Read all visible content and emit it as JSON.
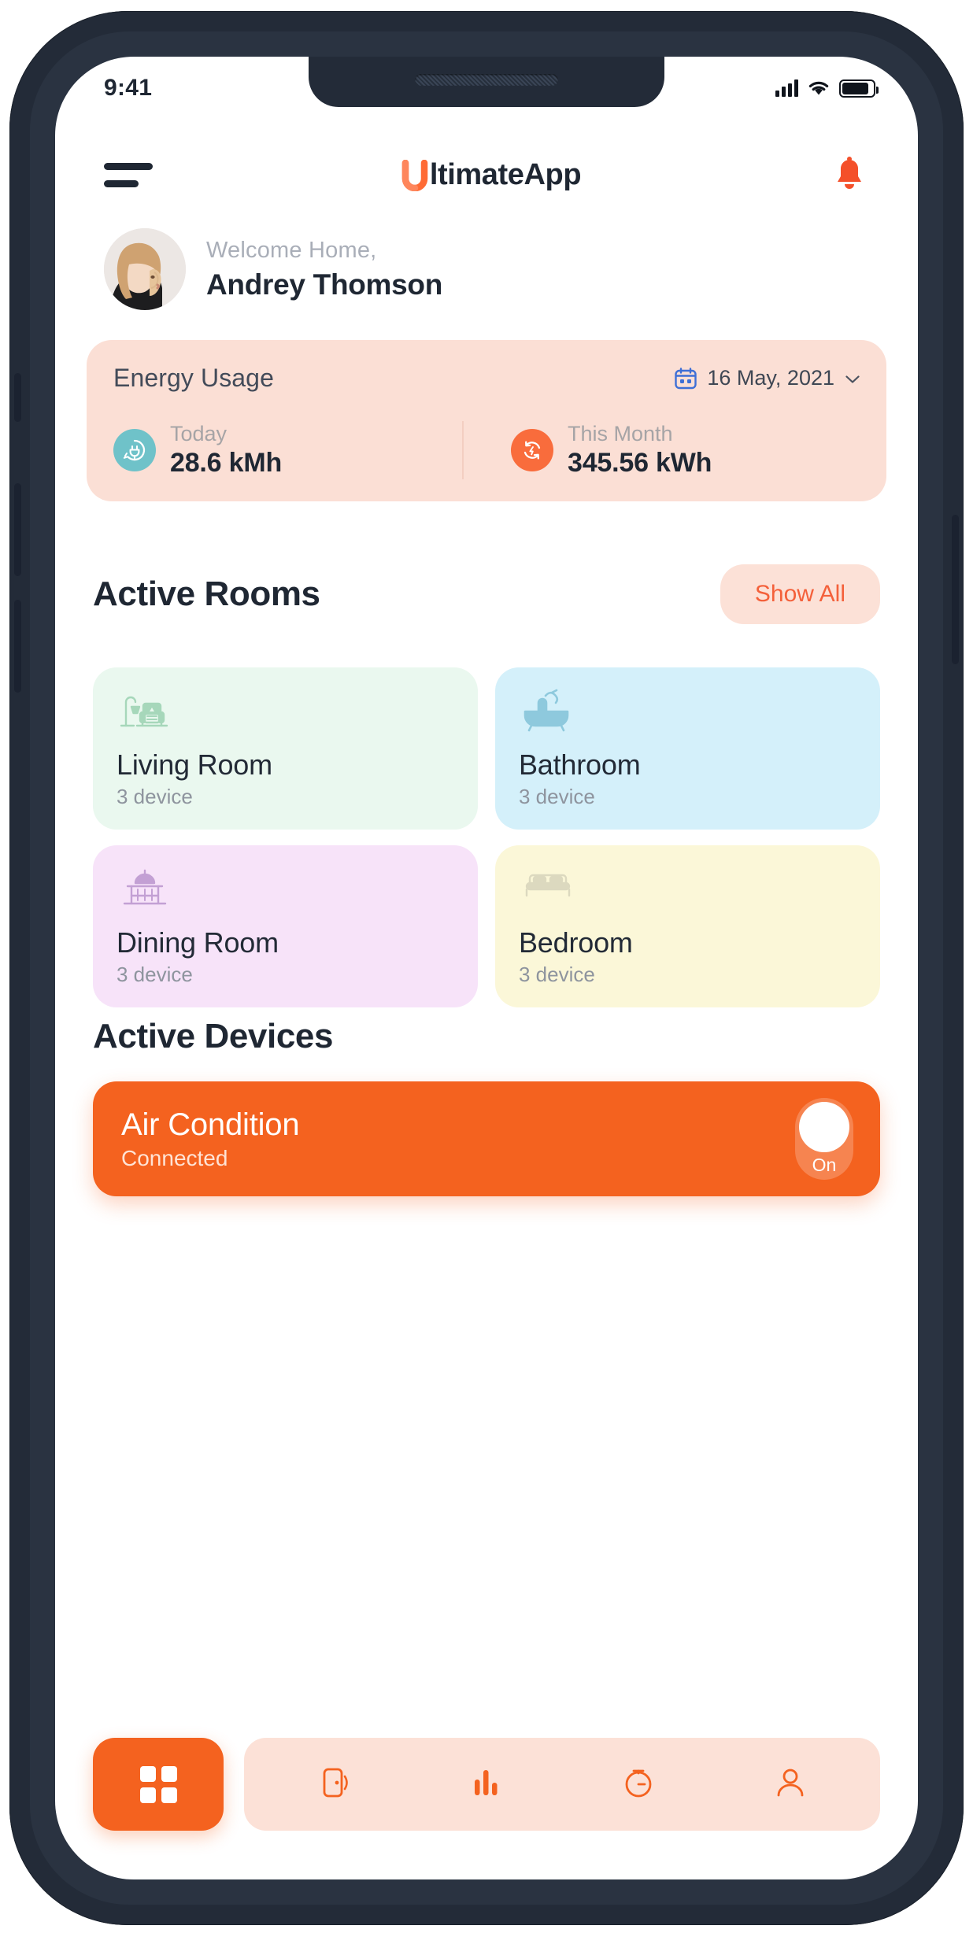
{
  "status_bar": {
    "time": "9:41",
    "signal_icon": "cellular-signal-icon",
    "wifi_icon": "wifi-icon",
    "battery_icon": "battery-icon"
  },
  "header": {
    "menu_icon": "hamburger-menu-icon",
    "brand_name": "ltimateApp",
    "brand_mark": "U",
    "brand_full": "UltimateApp",
    "notification_icon": "bell-icon"
  },
  "welcome": {
    "greeting": "Welcome Home,",
    "user_name": "Andrey Thomson",
    "avatar": "user-avatar"
  },
  "energy": {
    "title": "Energy Usage",
    "date": "16 May, 2021",
    "calendar_icon": "calendar-icon",
    "chevron_icon": "chevron-down-icon",
    "stats": [
      {
        "label": "Today",
        "value": "28.6 kMh",
        "icon": "plug-energy-icon",
        "icon_color": "#6fc2c9"
      },
      {
        "label": "This Month",
        "value": "345.56 kWh",
        "icon": "refresh-cycle-icon",
        "icon_color": "#f96c3c"
      }
    ],
    "card_color": "#fbdfd5"
  },
  "rooms_section": {
    "title": "Active Rooms",
    "show_all_label": "Show All",
    "rooms": [
      {
        "name": "Living Room",
        "devices": "3 device",
        "bg": "#eaf8ef",
        "icon": "floor-lamp-armchair-icon",
        "icon_color": "#a8d9bb"
      },
      {
        "name": "Bathroom",
        "devices": "3 device",
        "bg": "#d4f0fa",
        "icon": "bathtub-icon",
        "icon_color": "#8fc8da"
      },
      {
        "name": "Dining Room",
        "devices": "3 device",
        "bg": "#f7e3f9",
        "icon": "dining-table-icon",
        "icon_color": "#c7a3d6"
      },
      {
        "name": "Bedroom",
        "devices": "3 device",
        "bg": "#fbf7d8",
        "icon": "bed-icon",
        "icon_color": "#d8d6c0"
      }
    ]
  },
  "devices_section": {
    "title": "Active Devices",
    "device": {
      "name": "Air Condition",
      "status": "Connected",
      "toggle_label": "On",
      "toggle_state": "on",
      "card_color": "#f4621f"
    }
  },
  "bottom_nav": {
    "items": [
      {
        "name": "dashboard",
        "icon": "grid-dashboard-icon",
        "active": true
      },
      {
        "name": "devices",
        "icon": "door-device-icon",
        "active": false
      },
      {
        "name": "stats",
        "icon": "bar-chart-icon",
        "active": false
      },
      {
        "name": "timer",
        "icon": "stopwatch-icon",
        "active": false
      },
      {
        "name": "profile",
        "icon": "person-icon",
        "active": false
      }
    ],
    "accent_color": "#f4621f",
    "pill_color": "#fce1d7"
  }
}
